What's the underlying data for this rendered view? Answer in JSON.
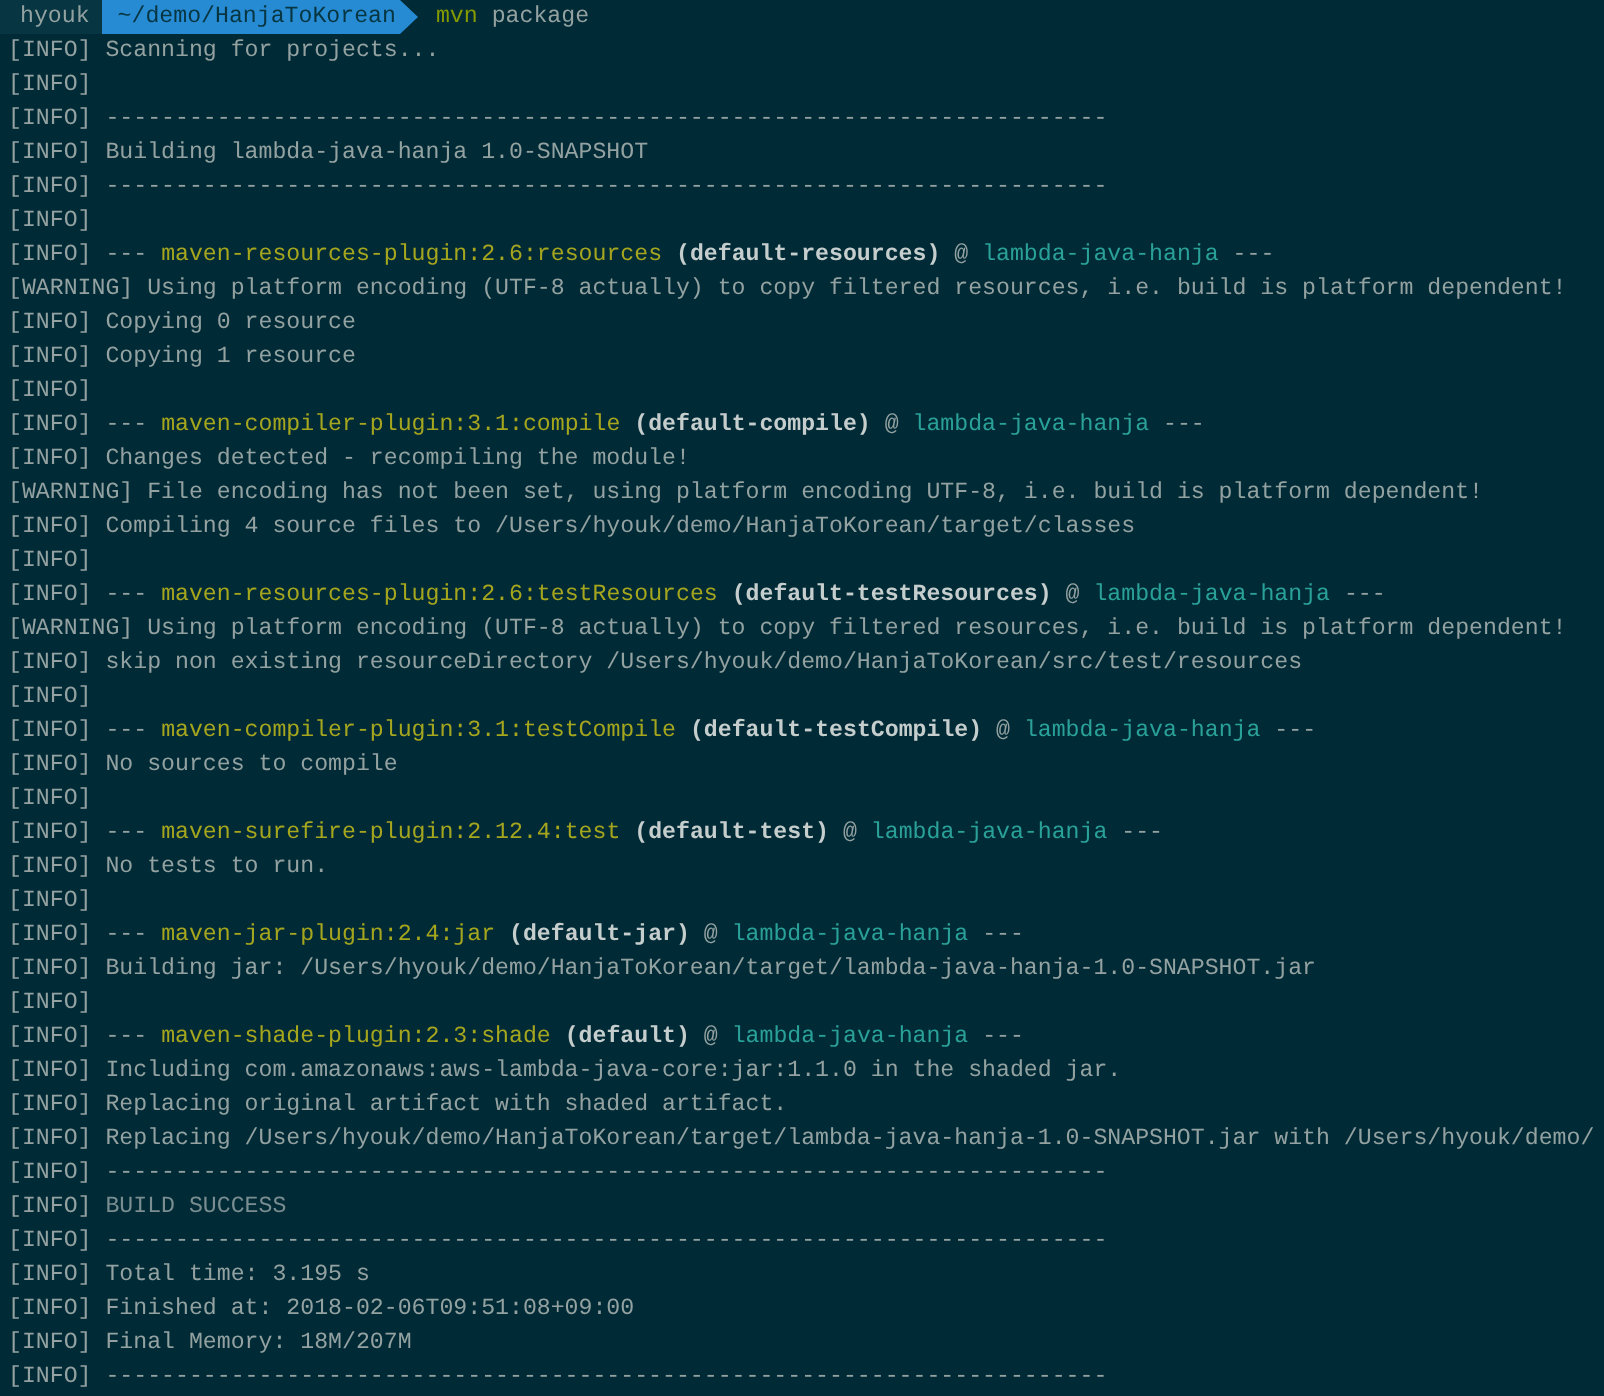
{
  "prompt": {
    "user": "hyouk",
    "path": "~/demo/HanjaToKorean",
    "command": "mvn",
    "args": "package"
  },
  "lines": [
    {
      "tag": "[INFO]",
      "parts": [
        {
          "kind": "text",
          "text": "Scanning for projects..."
        }
      ]
    },
    {
      "tag": "[INFO]"
    },
    {
      "tag": "[INFO]",
      "parts": [
        {
          "kind": "text",
          "text": "------------------------------------------------------------------------"
        }
      ]
    },
    {
      "tag": "[INFO]",
      "parts": [
        {
          "kind": "text",
          "text": "Building lambda-java-hanja 1.0-SNAPSHOT"
        }
      ]
    },
    {
      "tag": "[INFO]",
      "parts": [
        {
          "kind": "text",
          "text": "------------------------------------------------------------------------"
        }
      ]
    },
    {
      "tag": "[INFO]"
    },
    {
      "tag": "[INFO]",
      "parts": [
        {
          "kind": "text",
          "text": "--- "
        },
        {
          "kind": "plugin",
          "text": "maven-resources-plugin:2.6:resources"
        },
        {
          "kind": "execution",
          "text": " (default-resources)"
        },
        {
          "kind": "text",
          "text": " @ "
        },
        {
          "kind": "artifact",
          "text": "lambda-java-hanja"
        },
        {
          "kind": "text",
          "text": " ---"
        }
      ]
    },
    {
      "tag": "[WARNING]",
      "parts": [
        {
          "kind": "text",
          "text": "Using platform encoding (UTF-8 actually) to copy filtered resources, i.e. build is platform dependent!"
        }
      ]
    },
    {
      "tag": "[INFO]",
      "parts": [
        {
          "kind": "text",
          "text": "Copying 0 resource"
        }
      ]
    },
    {
      "tag": "[INFO]",
      "parts": [
        {
          "kind": "text",
          "text": "Copying 1 resource"
        }
      ]
    },
    {
      "tag": "[INFO]"
    },
    {
      "tag": "[INFO]",
      "parts": [
        {
          "kind": "text",
          "text": "--- "
        },
        {
          "kind": "plugin",
          "text": "maven-compiler-plugin:3.1:compile"
        },
        {
          "kind": "execution",
          "text": " (default-compile)"
        },
        {
          "kind": "text",
          "text": " @ "
        },
        {
          "kind": "artifact",
          "text": "lambda-java-hanja"
        },
        {
          "kind": "text",
          "text": " ---"
        }
      ]
    },
    {
      "tag": "[INFO]",
      "parts": [
        {
          "kind": "text",
          "text": "Changes detected - recompiling the module!"
        }
      ]
    },
    {
      "tag": "[WARNING]",
      "parts": [
        {
          "kind": "text",
          "text": "File encoding has not been set, using platform encoding UTF-8, i.e. build is platform dependent!"
        }
      ]
    },
    {
      "tag": "[INFO]",
      "parts": [
        {
          "kind": "text",
          "text": "Compiling 4 source files to /Users/hyouk/demo/HanjaToKorean/target/classes"
        }
      ]
    },
    {
      "tag": "[INFO]"
    },
    {
      "tag": "[INFO]",
      "parts": [
        {
          "kind": "text",
          "text": "--- "
        },
        {
          "kind": "plugin",
          "text": "maven-resources-plugin:2.6:testResources"
        },
        {
          "kind": "execution",
          "text": " (default-testResources)"
        },
        {
          "kind": "text",
          "text": " @ "
        },
        {
          "kind": "artifact",
          "text": "lambda-java-hanja"
        },
        {
          "kind": "text",
          "text": " ---"
        }
      ]
    },
    {
      "tag": "[WARNING]",
      "parts": [
        {
          "kind": "text",
          "text": "Using platform encoding (UTF-8 actually) to copy filtered resources, i.e. build is platform dependent!"
        }
      ]
    },
    {
      "tag": "[INFO]",
      "parts": [
        {
          "kind": "text",
          "text": "skip non existing resourceDirectory /Users/hyouk/demo/HanjaToKorean/src/test/resources"
        }
      ]
    },
    {
      "tag": "[INFO]"
    },
    {
      "tag": "[INFO]",
      "parts": [
        {
          "kind": "text",
          "text": "--- "
        },
        {
          "kind": "plugin",
          "text": "maven-compiler-plugin:3.1:testCompile"
        },
        {
          "kind": "execution",
          "text": " (default-testCompile)"
        },
        {
          "kind": "text",
          "text": " @ "
        },
        {
          "kind": "artifact",
          "text": "lambda-java-hanja"
        },
        {
          "kind": "text",
          "text": " ---"
        }
      ]
    },
    {
      "tag": "[INFO]",
      "parts": [
        {
          "kind": "text",
          "text": "No sources to compile"
        }
      ]
    },
    {
      "tag": "[INFO]"
    },
    {
      "tag": "[INFO]",
      "parts": [
        {
          "kind": "text",
          "text": "--- "
        },
        {
          "kind": "plugin",
          "text": "maven-surefire-plugin:2.12.4:test"
        },
        {
          "kind": "execution",
          "text": " (default-test)"
        },
        {
          "kind": "text",
          "text": " @ "
        },
        {
          "kind": "artifact",
          "text": "lambda-java-hanja"
        },
        {
          "kind": "text",
          "text": " ---"
        }
      ]
    },
    {
      "tag": "[INFO]",
      "parts": [
        {
          "kind": "text",
          "text": "No tests to run."
        }
      ]
    },
    {
      "tag": "[INFO]"
    },
    {
      "tag": "[INFO]",
      "parts": [
        {
          "kind": "text",
          "text": "--- "
        },
        {
          "kind": "plugin",
          "text": "maven-jar-plugin:2.4:jar"
        },
        {
          "kind": "execution",
          "text": " (default-jar)"
        },
        {
          "kind": "text",
          "text": " @ "
        },
        {
          "kind": "artifact",
          "text": "lambda-java-hanja"
        },
        {
          "kind": "text",
          "text": " ---"
        }
      ]
    },
    {
      "tag": "[INFO]",
      "parts": [
        {
          "kind": "text",
          "text": "Building jar: /Users/hyouk/demo/HanjaToKorean/target/lambda-java-hanja-1.0-SNAPSHOT.jar"
        }
      ]
    },
    {
      "tag": "[INFO]"
    },
    {
      "tag": "[INFO]",
      "parts": [
        {
          "kind": "text",
          "text": "--- "
        },
        {
          "kind": "plugin",
          "text": "maven-shade-plugin:2.3:shade"
        },
        {
          "kind": "execution",
          "text": " (default)"
        },
        {
          "kind": "text",
          "text": " @ "
        },
        {
          "kind": "artifact",
          "text": "lambda-java-hanja"
        },
        {
          "kind": "text",
          "text": " ---"
        }
      ]
    },
    {
      "tag": "[INFO]",
      "parts": [
        {
          "kind": "text",
          "text": "Including com.amazonaws:aws-lambda-java-core:jar:1.1.0 in the shaded jar."
        }
      ]
    },
    {
      "tag": "[INFO]",
      "parts": [
        {
          "kind": "text",
          "text": "Replacing original artifact with shaded artifact."
        }
      ]
    },
    {
      "tag": "[INFO]",
      "parts": [
        {
          "kind": "text",
          "text": "Replacing /Users/hyouk/demo/HanjaToKorean/target/lambda-java-hanja-1.0-SNAPSHOT.jar with /Users/hyouk/demo/"
        }
      ]
    },
    {
      "tag": "[INFO]",
      "parts": [
        {
          "kind": "text",
          "text": "------------------------------------------------------------------------"
        }
      ]
    },
    {
      "tag": "[INFO]",
      "parts": [
        {
          "kind": "status",
          "text": "BUILD SUCCESS"
        }
      ]
    },
    {
      "tag": "[INFO]",
      "parts": [
        {
          "kind": "text",
          "text": "------------------------------------------------------------------------"
        }
      ]
    },
    {
      "tag": "[INFO]",
      "parts": [
        {
          "kind": "text",
          "text": "Total time: 3.195 s"
        }
      ]
    },
    {
      "tag": "[INFO]",
      "parts": [
        {
          "kind": "text",
          "text": "Finished at: 2018-02-06T09:51:08+09:00"
        }
      ]
    },
    {
      "tag": "[INFO]",
      "parts": [
        {
          "kind": "text",
          "text": "Final Memory: 18M/207M"
        }
      ]
    },
    {
      "tag": "[INFO]",
      "parts": [
        {
          "kind": "text",
          "text": "------------------------------------------------------------------------"
        }
      ]
    }
  ]
}
